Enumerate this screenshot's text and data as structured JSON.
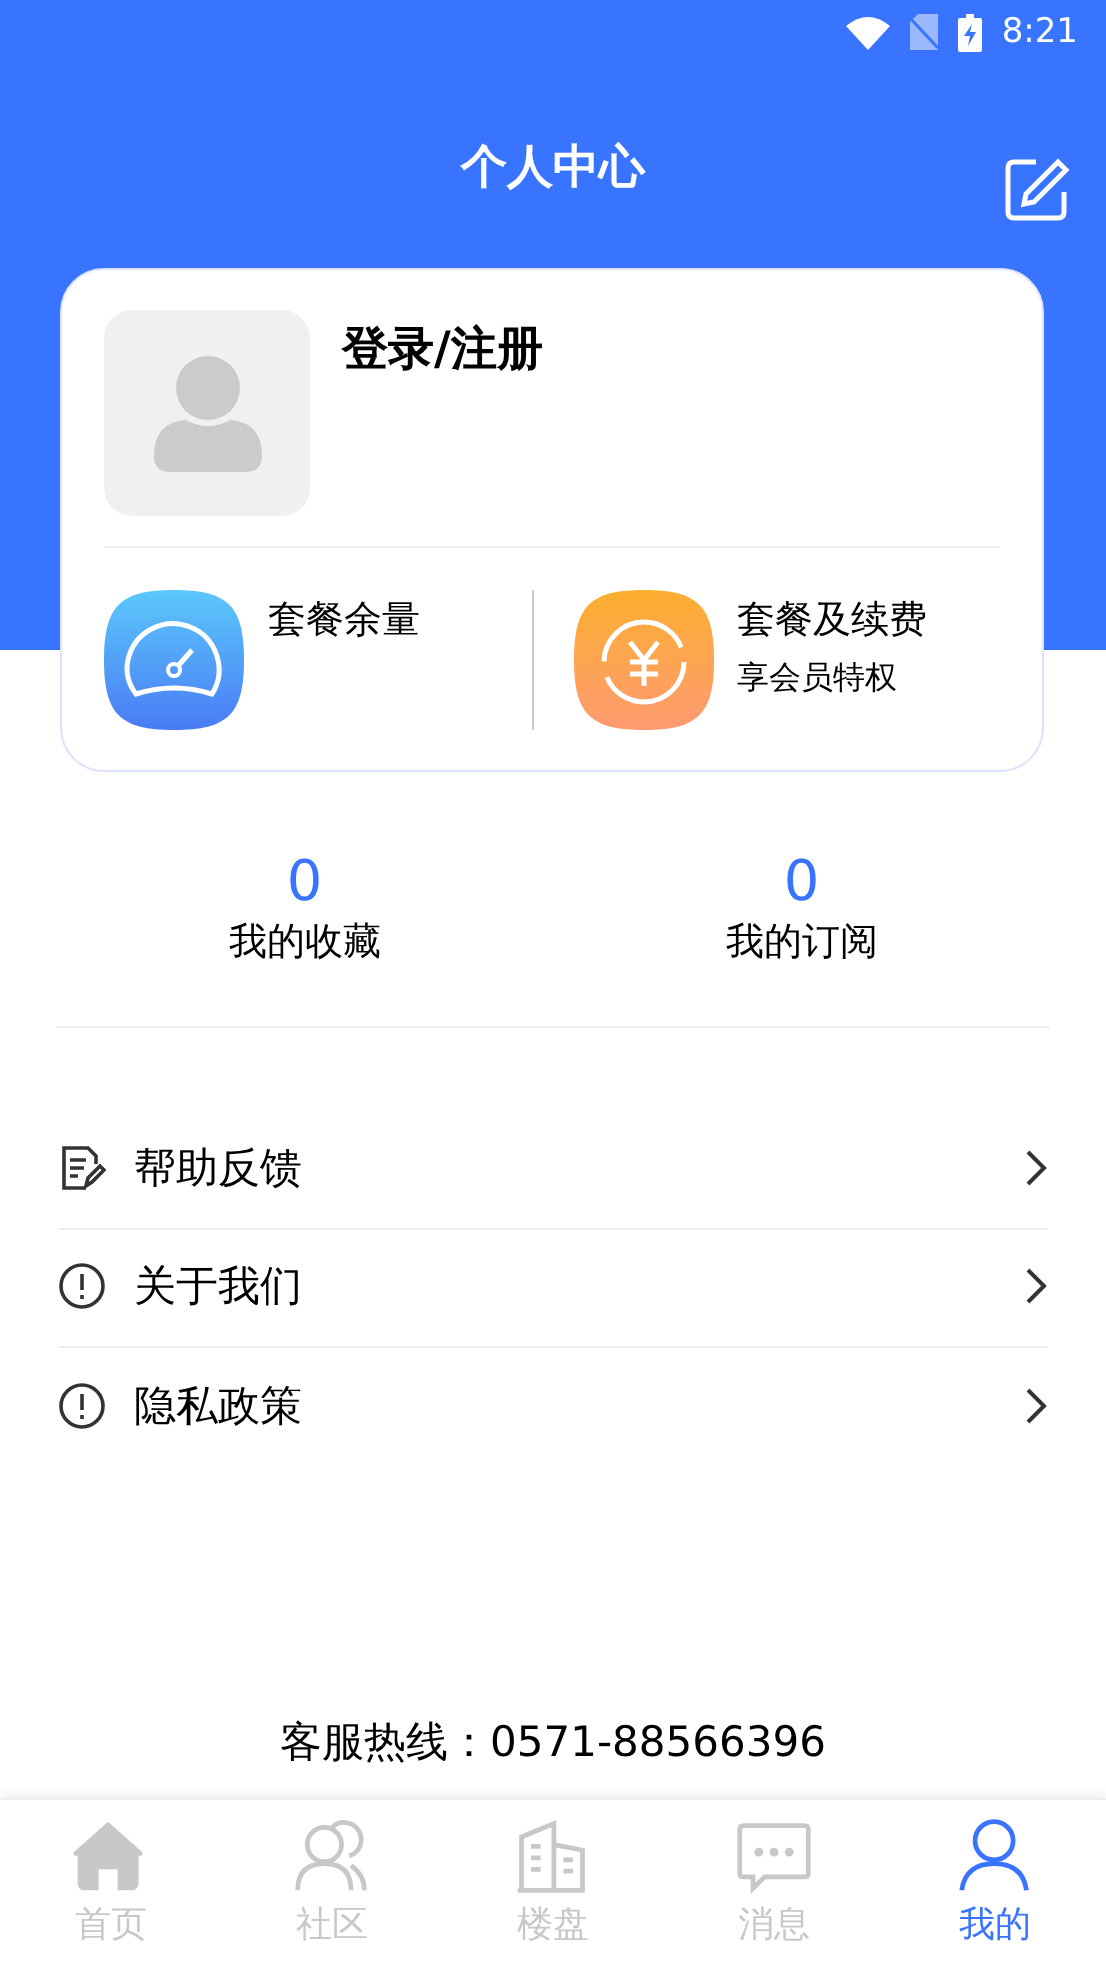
{
  "status_bar": {
    "time": "8:21"
  },
  "header": {
    "title": "个人中心"
  },
  "profile": {
    "login": "登录/注册"
  },
  "services": [
    {
      "kind": "speed",
      "title": "套餐余量"
    },
    {
      "kind": "yuan",
      "title": "套餐及续费",
      "subtitle": "享会员特权"
    }
  ],
  "stats": [
    {
      "value": "0",
      "label": "我的收藏"
    },
    {
      "value": "0",
      "label": "我的订阅"
    }
  ],
  "menu": [
    {
      "kind": "doc",
      "label": "帮助反馈"
    },
    {
      "kind": "info",
      "label": "关于我们"
    },
    {
      "kind": "info",
      "label": "隐私政策"
    }
  ],
  "hotline": "客服热线：0571-88566396",
  "tabs": [
    {
      "kind": "home",
      "label": "首页",
      "selected": false
    },
    {
      "kind": "people",
      "label": "社区",
      "selected": false
    },
    {
      "kind": "building",
      "label": "楼盘",
      "selected": false
    },
    {
      "kind": "chat",
      "label": "消息",
      "selected": false
    },
    {
      "kind": "person",
      "label": "我的",
      "selected": true
    }
  ]
}
